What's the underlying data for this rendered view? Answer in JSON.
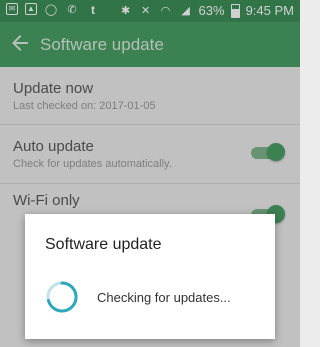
{
  "status_bar": {
    "left_icons": [
      "email-icon",
      "image-icon",
      "whatsapp-icon",
      "messenger-icon",
      "tumblr-icon"
    ],
    "tumblr_glyph": "t",
    "right_icons": [
      "bluetooth-icon",
      "mute-icon",
      "wifi-icon",
      "signal-icon",
      "battery-icon"
    ],
    "battery": "63%",
    "battery_level": 0.63,
    "time": "9:45 PM"
  },
  "app_bar": {
    "title": "Software update",
    "accent": "#4a9e64"
  },
  "settings": [
    {
      "title": "Update now",
      "subtitle": "Last checked on: 2017-01-05",
      "toggle": null
    },
    {
      "title": "Auto update",
      "subtitle": "Check for updates automatically.",
      "toggle": true
    },
    {
      "title": "Wi-Fi only",
      "subtitle": "",
      "toggle": true
    }
  ],
  "dialog": {
    "title": "Software update",
    "message": "Checking for updates..."
  }
}
